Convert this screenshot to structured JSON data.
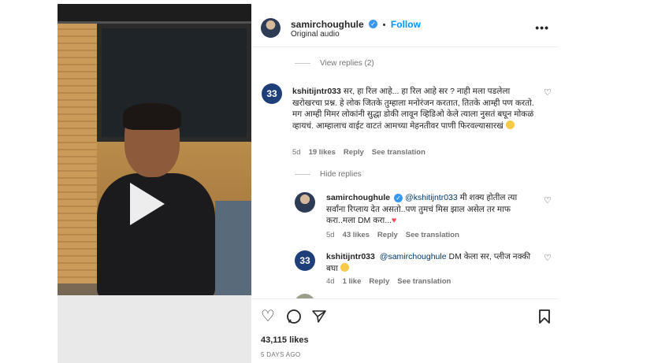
{
  "post": {
    "username": "samirchoughule",
    "follow_label": "Follow",
    "audio": "Original audio",
    "more_label": "•••"
  },
  "comments": {
    "view_replies": "View replies (2)",
    "hide_replies": "Hide replies",
    "items": [
      {
        "username": "kshitijntr033",
        "text": "सर, हा रिल आहे... हा रिल आहे सर ? नाही मला पडलेला खरोखरचा प्रश्न. हे लोक जितके तुम्हाला मनोरंजन करतात, तितके आम्ही पण करतो. मग आम्ही मिमर लोकांनी सुद्धा डोकी लावून व्हिडिओ केले त्याला नुसतं बघून मोकळं व्हायचं. आम्हालाच वाईट वाटतं आमच्या मेहनतीवर पाणी फिरवल्यासारखं",
        "age": "5d",
        "likes": "19 likes",
        "reply": "Reply",
        "translate": "See translation"
      },
      {
        "username": "samirchoughule",
        "mention": "@kshitijntr033",
        "text": "मी शक्य होतील त्या सर्वांना रिप्लाय देत असतो..पण तुमचं मिस झाल असेल तर माफ करा..मला DM करा...",
        "age": "5d",
        "likes": "43 likes",
        "reply": "Reply",
        "translate": "See translation"
      },
      {
        "username": "kshitijntr033",
        "mention": "@samirchoughule",
        "text": "DM केला सर, प्लीज नक्की बघा",
        "age": "4d",
        "likes": "1 like",
        "reply": "Reply",
        "translate": "See translation"
      }
    ]
  },
  "footer": {
    "likes_count": "43,115 likes",
    "posted": "5 DAYS AGO"
  },
  "icons": {
    "heart": "♡",
    "comment": "○",
    "share": "➤",
    "bookmark": "⌑"
  },
  "colors": {
    "accent": "#0095f6",
    "verified": "#3897f0",
    "muted": "#737373"
  }
}
